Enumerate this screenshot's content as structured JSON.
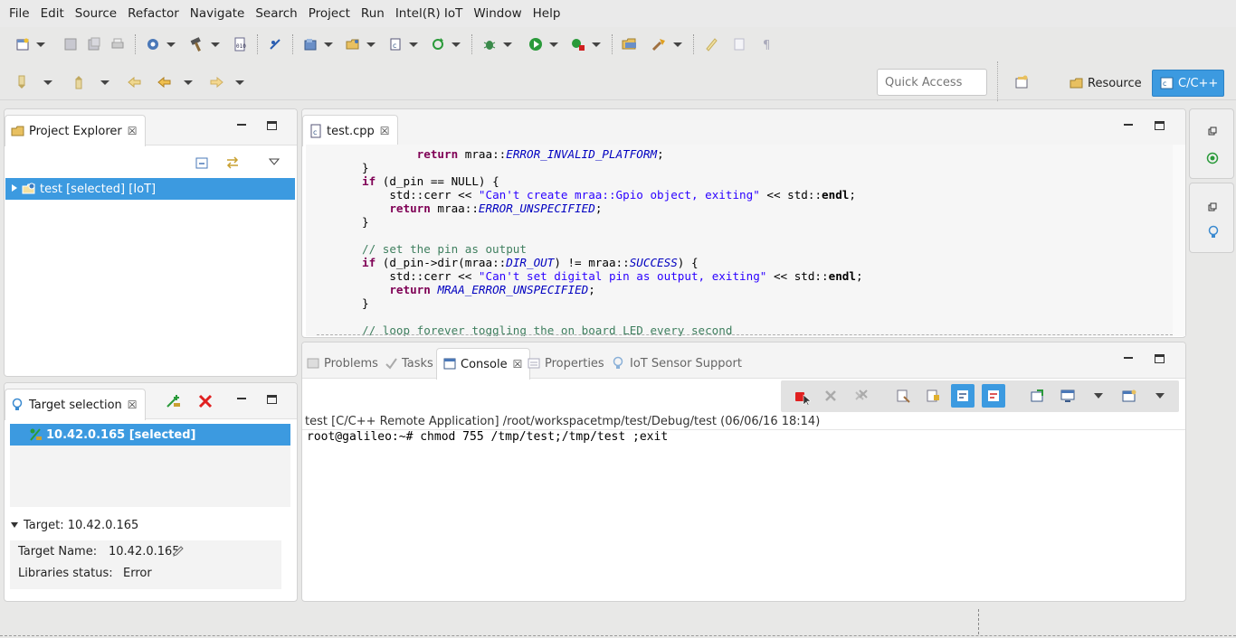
{
  "menu": [
    "File",
    "Edit",
    "Source",
    "Refactor",
    "Navigate",
    "Search",
    "Project",
    "Run",
    "Intel(R) IoT",
    "Window",
    "Help"
  ],
  "quick_access": {
    "placeholder": "Quick Access"
  },
  "perspectives": {
    "resource": "Resource",
    "cpp": "C/C++"
  },
  "project_explorer": {
    "title": "Project Explorer",
    "tree": [
      {
        "label": "test [selected] [IoT]"
      }
    ]
  },
  "editor": {
    "tab": "test.cpp",
    "lines": [
      {
        "segs": [
          {
            "t": "        "
          },
          {
            "t": "return",
            "c": "kw"
          },
          {
            "t": " mraa::"
          },
          {
            "t": "ERROR_INVALID_PLATFORM",
            "c": "ital"
          },
          {
            "t": ";"
          }
        ]
      },
      {
        "segs": [
          {
            "t": "}"
          }
        ]
      },
      {
        "segs": [
          {
            "t": "if",
            "c": "kw"
          },
          {
            "t": " (d_pin == NULL) {"
          }
        ]
      },
      {
        "segs": [
          {
            "t": "    std::cerr << "
          },
          {
            "t": "\"Can't create mraa::Gpio object, exiting\"",
            "c": "str"
          },
          {
            "t": " << std::"
          },
          {
            "t": "endl",
            "c": "bold"
          },
          {
            "t": ";"
          }
        ]
      },
      {
        "segs": [
          {
            "t": "    "
          },
          {
            "t": "return",
            "c": "kw"
          },
          {
            "t": " mraa::"
          },
          {
            "t": "ERROR_UNSPECIFIED",
            "c": "ital"
          },
          {
            "t": ";"
          }
        ]
      },
      {
        "segs": [
          {
            "t": "}"
          }
        ]
      },
      {
        "segs": [
          {
            "t": ""
          }
        ]
      },
      {
        "segs": [
          {
            "t": "// set the pin as output",
            "c": "cmt"
          }
        ]
      },
      {
        "segs": [
          {
            "t": "if",
            "c": "kw"
          },
          {
            "t": " (d_pin->dir(mraa::"
          },
          {
            "t": "DIR_OUT",
            "c": "ital"
          },
          {
            "t": ") != mraa::"
          },
          {
            "t": "SUCCESS",
            "c": "ital"
          },
          {
            "t": ") {"
          }
        ]
      },
      {
        "segs": [
          {
            "t": "    std::cerr << "
          },
          {
            "t": "\"Can't set digital pin as output, exiting\"",
            "c": "str"
          },
          {
            "t": " << std::"
          },
          {
            "t": "endl",
            "c": "bold"
          },
          {
            "t": ";"
          }
        ]
      },
      {
        "segs": [
          {
            "t": "    "
          },
          {
            "t": "return",
            "c": "kw"
          },
          {
            "t": " "
          },
          {
            "t": "MRAA_ERROR_UNSPECIFIED",
            "c": "ital"
          },
          {
            "t": ";"
          }
        ]
      },
      {
        "segs": [
          {
            "t": "}"
          }
        ]
      },
      {
        "segs": [
          {
            "t": ""
          }
        ]
      },
      {
        "segs": [
          {
            "t": "// loop forever toggling the on board LED every second",
            "c": "cmt"
          }
        ]
      }
    ]
  },
  "bottom_tabs": {
    "problems": "Problems",
    "tasks": "Tasks",
    "console": "Console",
    "properties": "Properties",
    "iot_sensor": "IoT Sensor Support"
  },
  "console": {
    "title": "test [C/C++ Remote Application] /root/workspacetmp/test/Debug/test (06/06/16 18:14)",
    "output": "root@galileo:~# chmod 755 /tmp/test;/tmp/test ;exit"
  },
  "target_selection": {
    "title": "Target selection",
    "selected": "10.42.0.165 [selected]",
    "section": "Target: 10.42.0.165",
    "name_label": "Target Name:",
    "name_value": "10.42.0.165",
    "lib_label": "Libraries status:",
    "lib_value": "Error"
  },
  "colors": {
    "accent": "#3c9ae0",
    "stop_red": "#e02020"
  }
}
